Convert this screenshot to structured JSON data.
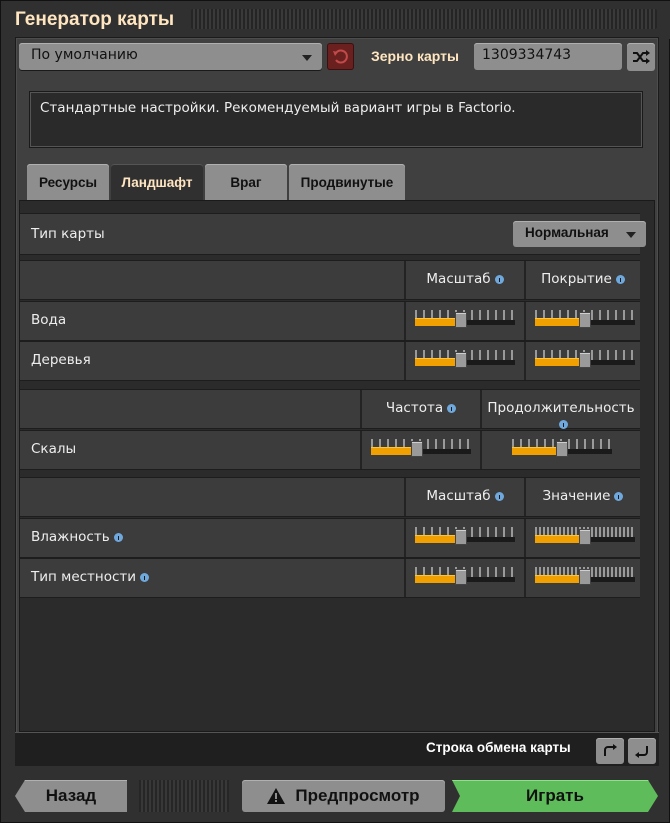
{
  "window": {
    "title": "Генератор карты"
  },
  "preset": {
    "value": "По умолчанию",
    "icon": "chevron-down-icon"
  },
  "seed": {
    "label": "Зерно карты",
    "value": "1309334743"
  },
  "description": "Стандартные настройки. Рекомендуемый вариант игры в Factorio.",
  "tabs": [
    {
      "label": "Ресурсы",
      "active": false
    },
    {
      "label": "Ландшафт",
      "active": true
    },
    {
      "label": "Враг",
      "active": false
    },
    {
      "label": "Продвинутые",
      "active": false
    }
  ],
  "map_type": {
    "label": "Тип карты",
    "value": "Нормальная"
  },
  "section1": {
    "col1": "Масштаб",
    "col2": "Покрытие",
    "rows": [
      {
        "label": "Вода",
        "s1": 0.45,
        "s2": 0.5
      },
      {
        "label": "Деревья",
        "s1": 0.45,
        "s2": 0.5
      }
    ]
  },
  "section2": {
    "col1": "Частота",
    "col2": "Продолжительность",
    "rows": [
      {
        "label": "Скалы",
        "s1": 0.45,
        "s2": 0.5
      }
    ]
  },
  "section3": {
    "col1": "Масштаб",
    "col2": "Значение",
    "rows": [
      {
        "label": "Влажность",
        "s1": 0.45,
        "s2": 0.5
      },
      {
        "label": "Тип местности",
        "s1": 0.45,
        "s2": 0.5
      }
    ]
  },
  "exchange": {
    "label": "Строка обмена карты"
  },
  "buttons": {
    "back": "Назад",
    "preview": "Предпросмотр",
    "play": "Играть"
  },
  "colors": {
    "accent_orange": "#f0a000",
    "play_green": "#5ebd5a",
    "title": "#ffe6c0"
  }
}
